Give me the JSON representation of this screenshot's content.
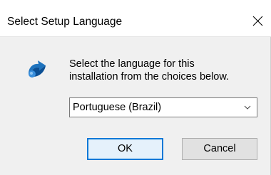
{
  "window": {
    "title": "Select Setup Language",
    "close_icon": "close-icon"
  },
  "body": {
    "icon": "setup-installer-icon",
    "message_line1": "Select the language for this",
    "message_line2": "installation from the choices below."
  },
  "language_select": {
    "selected": "Portuguese (Brazil)",
    "icon": "chevron-down-icon"
  },
  "buttons": {
    "ok_label": "OK",
    "cancel_label": "Cancel"
  },
  "colors": {
    "accent": "#0078d7",
    "dialog_background": "#f0f0f0",
    "title_bar": "#ffffff",
    "icon_blue": "#1e73be"
  }
}
